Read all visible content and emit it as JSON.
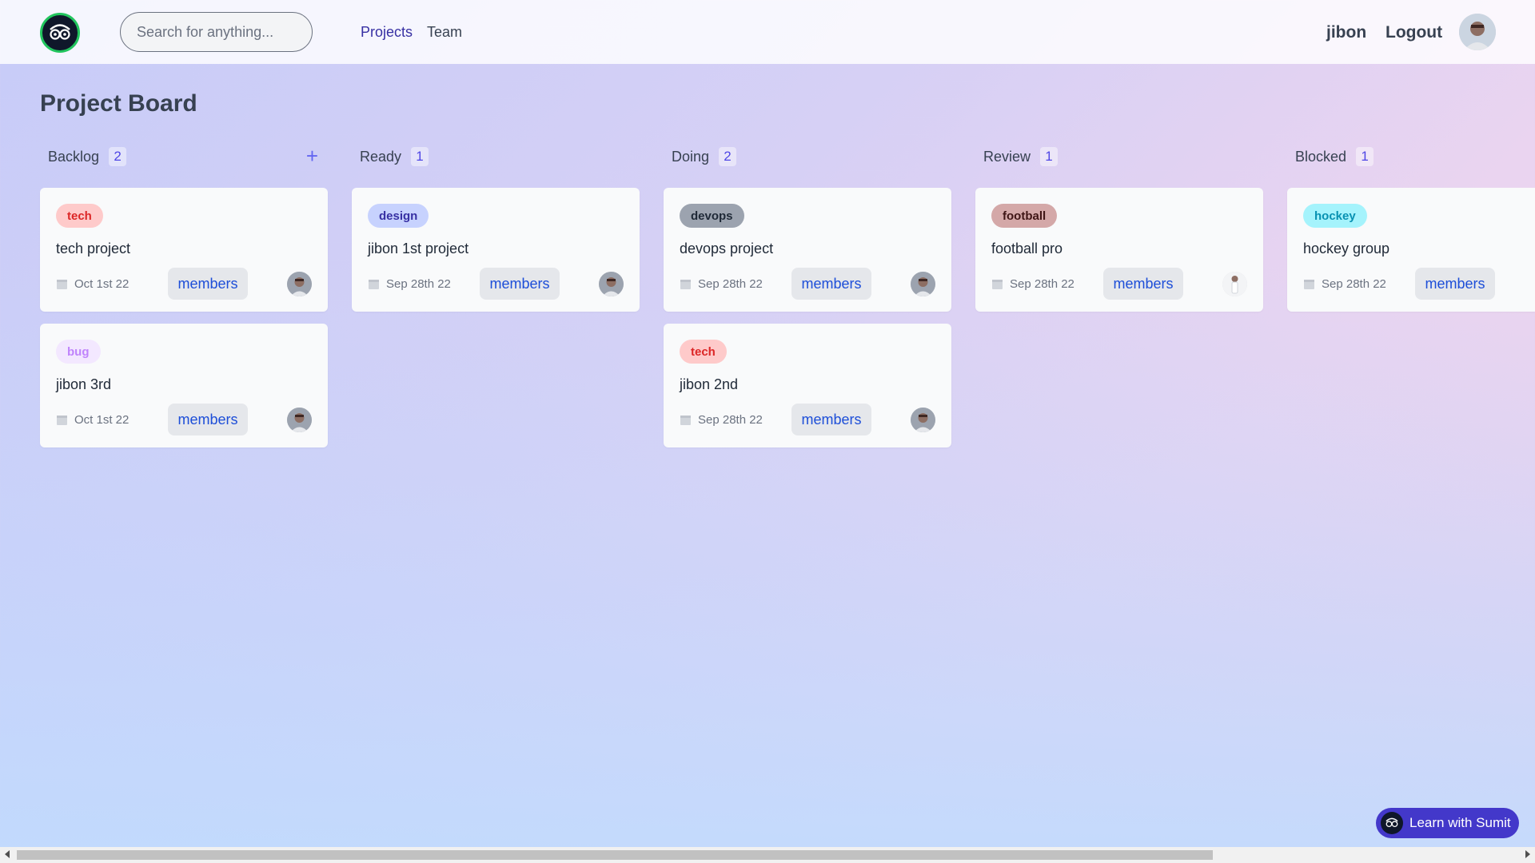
{
  "header": {
    "search_placeholder": "Search for anything...",
    "nav": {
      "projects": "Projects",
      "team": "Team"
    },
    "user_name": "jibon",
    "logout": "Logout"
  },
  "page_title": "Project Board",
  "columns": [
    {
      "title": "Backlog",
      "count": "2",
      "add_icon": "+",
      "cards": [
        {
          "tag": "tech",
          "title": "tech project",
          "date": "Oct 1st 22",
          "members_label": "members"
        },
        {
          "tag": "bug",
          "title": "jibon 3rd",
          "date": "Oct 1st 22",
          "members_label": "members"
        }
      ]
    },
    {
      "title": "Ready",
      "count": "1",
      "cards": [
        {
          "tag": "design",
          "title": "jibon 1st project",
          "date": "Sep 28th 22",
          "members_label": "members"
        }
      ]
    },
    {
      "title": "Doing",
      "count": "2",
      "cards": [
        {
          "tag": "devops",
          "title": "devops project",
          "date": "Sep 28th 22",
          "members_label": "members"
        },
        {
          "tag": "tech",
          "title": "jibon 2nd",
          "date": "Sep 28th 22",
          "members_label": "members"
        }
      ]
    },
    {
      "title": "Review",
      "count": "1",
      "cards": [
        {
          "tag": "football",
          "title": "football pro",
          "date": "Sep 28th 22",
          "members_label": "members"
        }
      ]
    },
    {
      "title": "Blocked",
      "count": "1",
      "cards": [
        {
          "tag": "hockey",
          "title": "hockey group",
          "date": "Sep 28th 22",
          "members_label": "members"
        }
      ]
    }
  ],
  "learn_button": "Learn with Sumit",
  "colors": {
    "accent": "#4338ca",
    "tag_tech_bg": "#fecaca",
    "tag_tech_fg": "#dc2626",
    "tag_bug_bg": "#f3e8ff",
    "tag_bug_fg": "#c084fc",
    "tag_design_bg": "#c7d2fe",
    "tag_design_fg": "#3730a3",
    "tag_devops_bg": "#9ca3af",
    "tag_devops_fg": "#1f2937",
    "tag_football_bg": "#d4a8a8",
    "tag_football_fg": "#3f1515",
    "tag_hockey_bg": "#a5f3fc",
    "tag_hockey_fg": "#0891b2"
  }
}
